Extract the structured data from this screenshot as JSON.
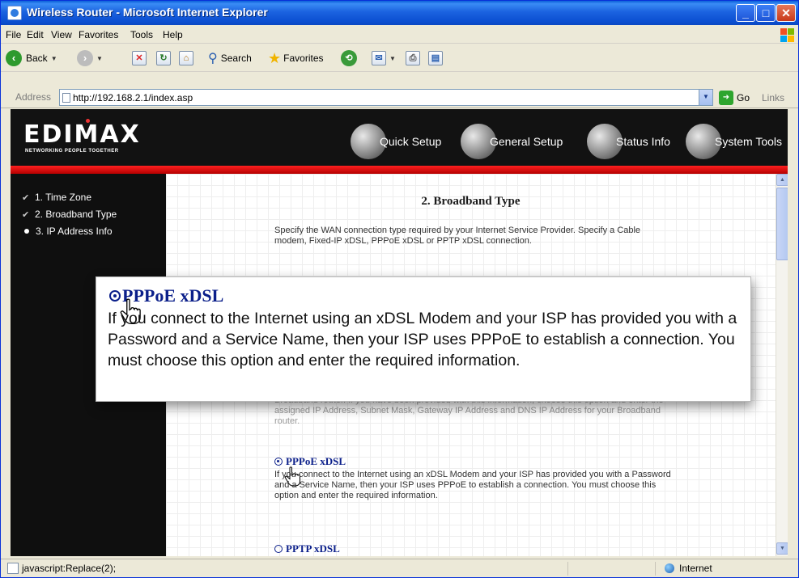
{
  "window": {
    "title": "Wireless Router - Microsoft Internet Explorer"
  },
  "menu": [
    "File",
    "Edit",
    "View",
    "Favorites",
    "Tools",
    "Help"
  ],
  "toolbar": {
    "back": "Back",
    "search": "Search",
    "favorites": "Favorites"
  },
  "address": {
    "label": "Address",
    "url": "http://192.168.2.1/index.asp",
    "go": "Go",
    "links": "Links"
  },
  "banner": {
    "logo": "EDIMAX",
    "tagline": "NETWORKING PEOPLE TOGETHER",
    "nav": [
      "Quick Setup",
      "General Setup",
      "Status Info",
      "System Tools"
    ]
  },
  "sidebar": {
    "items": [
      {
        "label": "1. Time Zone",
        "marker": "check"
      },
      {
        "label": "2. Broadband Type",
        "marker": "check"
      },
      {
        "label": "3. IP Address Info",
        "marker": "dot"
      }
    ]
  },
  "main": {
    "heading": "2. Broadband Type",
    "intro": "Specify the WAN connection type required by your Internet Service Provider. Specify a Cable modem, Fixed-IP xDSL, PPPoE xDSL or PPTP xDSL connection.",
    "fixed_ip_tail": "Broadband router. If you have been provided with this information, choose this option and enter the assigned IP Address, Subnet Mask, Gateway IP Address and DNS IP Address for your Broadband router.",
    "pppoe_title": "PPPoE xDSL",
    "pppoe_text": "If you connect to the Internet using an xDSL Modem and your ISP has provided you with a Password and a Service Name, then your ISP uses PPPoE to establish a connection. You must choose this option and enter the required information.",
    "pptp_title": "PPTP xDSL"
  },
  "callout": {
    "title": "PPPoE xDSL",
    "text": "If you connect to the Internet using an xDSL Modem and your ISP has provided you with a Password and a Service Name, then your ISP uses PPPoE to establish a connection. You must choose this option and enter the required information."
  },
  "status": {
    "text": "javascript:Replace(2);",
    "zone": "Internet"
  },
  "colors": {
    "titlebar": "#0b4fd1",
    "banner": "#121212",
    "accent_red": "#e00000",
    "link_blue": "#0b1f8a"
  }
}
